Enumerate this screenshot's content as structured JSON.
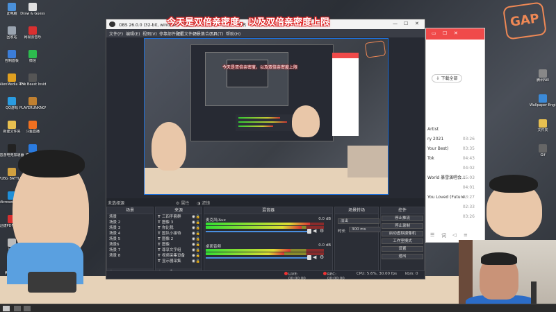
{
  "banner": "今天是双倍亲密度，以及双倍亲密度上限",
  "nested_banner": "今天是双倍亲密度，以及双倍亲密度上限",
  "logo_text": "GAP",
  "desktop_icons_left": [
    {
      "label": "此电脑",
      "color": "#4a90d9"
    },
    {
      "label": "回收站",
      "color": "#9aa4b0"
    },
    {
      "label": "控制面板",
      "color": "#3b7dd8"
    },
    {
      "label": "AlienMedia RECentral 4",
      "color": "#e0a020"
    },
    {
      "label": "QQ游戏",
      "color": "#2a9be0"
    },
    {
      "label": "新建文件夹",
      "color": "#e8c050"
    },
    {
      "label": "音游电竞加速器",
      "color": "#222"
    },
    {
      "label": "PUBG BATTLEGROUNDS",
      "color": "#d0a040"
    },
    {
      "label": "Microsoft Edge",
      "color": "#1f8fd8"
    },
    {
      "label": "迅捷PDF编辑器",
      "color": "#d83030"
    },
    {
      "label": "回收",
      "color": "#bbb"
    },
    {
      "label": "腾讯视频",
      "color": "#2ea0f0"
    }
  ],
  "desktop_icons_col2": [
    {
      "label": "Draw & Guess",
      "color": "#e0e0e0"
    },
    {
      "label": "网易云音乐",
      "color": "#d83030"
    },
    {
      "label": "微信",
      "color": "#2dbb4e"
    },
    {
      "label": "The Beast Inside",
      "color": "#555"
    },
    {
      "label": "PLAYERUNKNOWN'S B...",
      "color": "#c08030"
    },
    {
      "label": "斗鱼直播",
      "color": "#f07020"
    },
    {
      "label": "腾讯会议",
      "color": "#2a7be0"
    },
    {
      "label": "酷狗音乐",
      "color": "#2a80e0"
    },
    {
      "label": "哔哩哔哩",
      "color": "#f06090"
    },
    {
      "label": "爱奇艺",
      "color": "#28c040"
    }
  ],
  "desktop_icons_right": [
    {
      "label": "腾讯Nill",
      "color": "#888"
    },
    {
      "label": "Wallpaper Engine",
      "color": "#3b8ad8"
    },
    {
      "label": "文件夹",
      "color": "#e8c050"
    },
    {
      "label": "Gif",
      "color": "#666"
    }
  ],
  "music_app": {
    "download_all": "下载全部",
    "songs": [
      {
        "title": "Artist",
        "duration": ""
      },
      {
        "title": "ry 2021",
        "duration": "03:26"
      },
      {
        "title": "Your Best)",
        "duration": "03:35"
      },
      {
        "title": "Tok",
        "duration": "04:43"
      },
      {
        "title": "",
        "duration": "04:02"
      },
      {
        "title": "World 暴雪演唱会...",
        "duration": "05:03"
      },
      {
        "title": "",
        "duration": "04:01"
      },
      {
        "title": "You Loved (Future...",
        "duration": "03:27"
      },
      {
        "title": "",
        "duration": "02:33"
      },
      {
        "title": "",
        "duration": "03:26"
      }
    ]
  },
  "obs": {
    "title": "OBS 26.0.0 (32-bit, windows) - 配置文件：未命名 - 场景：未命名",
    "menu": [
      "文件(F)",
      "编辑(E)",
      "视图(V)",
      "停靠部件(D)",
      "配置文件(P)",
      "场景集合(S)",
      "工具(T)",
      "帮助(H)"
    ],
    "no_source": "未选择源",
    "properties": "属性",
    "filters": "滤镜",
    "scenes": {
      "header": "场景",
      "items": [
        "场景",
        "场景 2",
        "场景 3",
        "场景 4",
        "场景 5",
        "场景6",
        "场景 7",
        "场景 8"
      ]
    },
    "sources": {
      "header": "来源",
      "items": [
        "三四手套群",
        "图像 3",
        "你比我",
        "国队小接待",
        "图像 2",
        "图像",
        "尊享文字组",
        "视频采集设备",
        "显示器采集"
      ]
    },
    "mixer": {
      "header": "混音器",
      "channels": [
        {
          "name": "麦克风/Aux",
          "db": "0.0 dB",
          "level": 0.88
        },
        {
          "name": "桌面音频",
          "db": "0.0 dB",
          "level": 0.72
        }
      ]
    },
    "transitions": {
      "header": "场景转场",
      "selected": "淡出",
      "duration_label": "时长",
      "duration": "300 ms"
    },
    "controls": {
      "header": "控件",
      "buttons": [
        "停止推流",
        "停止录制",
        "启动虚拟摄像机",
        "工作室模式",
        "设置",
        "退出"
      ]
    },
    "status": {
      "live": "LIVE: 00:00:00",
      "rec": "REC: 00:00:00",
      "cpu": "CPU: 5.6%, 30.00 fps",
      "kbps": "kb/s: 0"
    }
  },
  "colors": {
    "accent": "#1e6fd9",
    "music_red": "#f04a4a",
    "banner_outline": "#d22"
  }
}
